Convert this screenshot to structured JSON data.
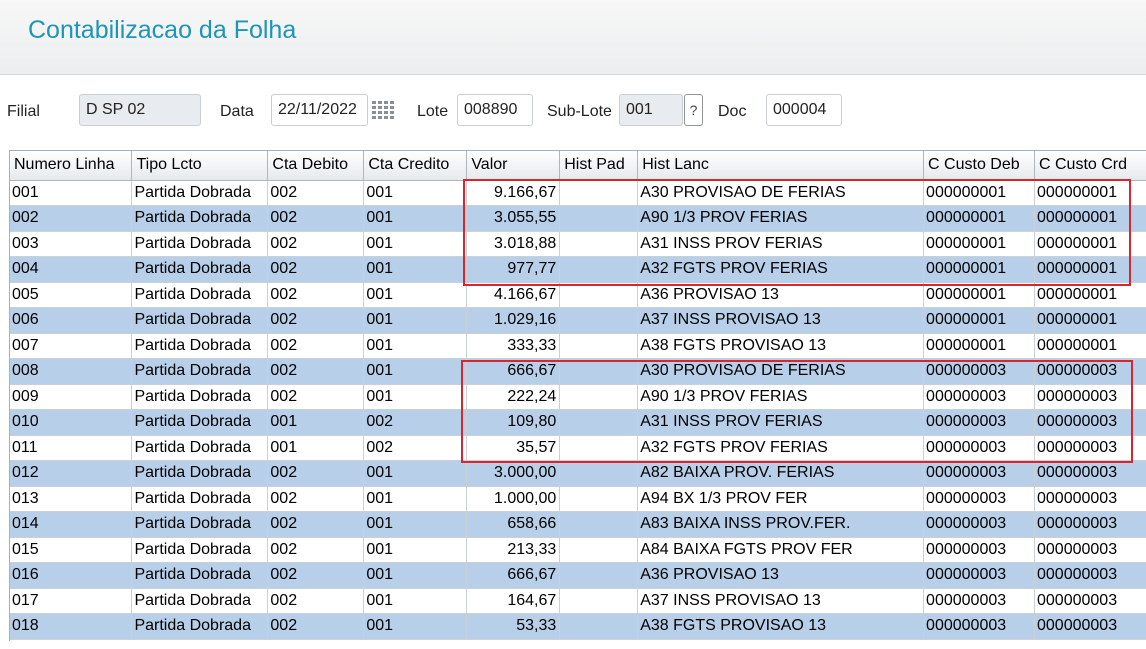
{
  "window": {
    "title": "Contabilizacao da Folha"
  },
  "form": {
    "filial_label": "Filial",
    "filial_value": "D SP 02",
    "data_label": "Data",
    "data_value": "22/11/2022",
    "lote_label": "Lote",
    "lote_value": "008890",
    "sublote_label": "Sub-Lote",
    "sublote_value": "001",
    "sublote_lookup": "?",
    "doc_label": "Doc",
    "doc_value": "000004"
  },
  "grid": {
    "columns": [
      "Numero Linha",
      "Tipo Lcto",
      "Cta Debito",
      "Cta Credito",
      "Valor",
      "Hist Pad",
      "Hist Lanc",
      "C Custo Deb",
      "C Custo Crd"
    ],
    "rows": [
      [
        "001",
        "Partida Dobrada",
        "002",
        "001",
        "9.166,67",
        "",
        "A30 PROVISAO DE FERIAS",
        "000000001",
        "000000001"
      ],
      [
        "002",
        "Partida Dobrada",
        "002",
        "001",
        "3.055,55",
        "",
        "A90 1/3 PROV FERIAS",
        "000000001",
        "000000001"
      ],
      [
        "003",
        "Partida Dobrada",
        "002",
        "001",
        "3.018,88",
        "",
        "A31 INSS PROV FERIAS",
        "000000001",
        "000000001"
      ],
      [
        "004",
        "Partida Dobrada",
        "002",
        "001",
        "977,77",
        "",
        "A32 FGTS PROV FERIAS",
        "000000001",
        "000000001"
      ],
      [
        "005",
        "Partida Dobrada",
        "002",
        "001",
        "4.166,67",
        "",
        "A36 PROVISAO 13",
        "000000001",
        "000000001"
      ],
      [
        "006",
        "Partida Dobrada",
        "002",
        "001",
        "1.029,16",
        "",
        "A37 INSS PROVISAO 13",
        "000000001",
        "000000001"
      ],
      [
        "007",
        "Partida Dobrada",
        "002",
        "001",
        "333,33",
        "",
        "A38 FGTS PROVISAO 13",
        "000000001",
        "000000001"
      ],
      [
        "008",
        "Partida Dobrada",
        "002",
        "001",
        "666,67",
        "",
        "A30 PROVISAO DE FERIAS",
        "000000003",
        "000000003"
      ],
      [
        "009",
        "Partida Dobrada",
        "002",
        "001",
        "222,24",
        "",
        "A90 1/3 PROV FERIAS",
        "000000003",
        "000000003"
      ],
      [
        "010",
        "Partida Dobrada",
        "001",
        "002",
        "109,80",
        "",
        "A31 INSS PROV FERIAS",
        "000000003",
        "000000003"
      ],
      [
        "011",
        "Partida Dobrada",
        "001",
        "002",
        "35,57",
        "",
        "A32 FGTS PROV FERIAS",
        "000000003",
        "000000003"
      ],
      [
        "012",
        "Partida Dobrada",
        "002",
        "001",
        "3.000,00",
        "",
        "A82 BAIXA PROV. FERIAS",
        "000000003",
        "000000003"
      ],
      [
        "013",
        "Partida Dobrada",
        "002",
        "001",
        "1.000,00",
        "",
        "A94 BX 1/3 PROV FER",
        "000000003",
        "000000003"
      ],
      [
        "014",
        "Partida Dobrada",
        "002",
        "001",
        "658,66",
        "",
        "A83 BAIXA INSS PROV.FER.",
        "000000003",
        "000000003"
      ],
      [
        "015",
        "Partida Dobrada",
        "002",
        "001",
        "213,33",
        "",
        "A84 BAIXA FGTS PROV FER",
        "000000003",
        "000000003"
      ],
      [
        "016",
        "Partida Dobrada",
        "002",
        "001",
        "666,67",
        "",
        "A36 PROVISAO 13",
        "000000003",
        "000000003"
      ],
      [
        "017",
        "Partida Dobrada",
        "002",
        "001",
        "164,67",
        "",
        "A37 INSS PROVISAO 13",
        "000000003",
        "000000003"
      ],
      [
        "018",
        "Partida Dobrada",
        "002",
        "001",
        "53,33",
        "",
        "A38 FGTS PROVISAO 13",
        "000000003",
        "000000003"
      ]
    ]
  },
  "colors": {
    "title": "#1f95b5",
    "alt_row": "#b7cfe8",
    "highlight": "#d8262e"
  },
  "icons": {
    "date_picker": "calendar-grid-icon"
  }
}
